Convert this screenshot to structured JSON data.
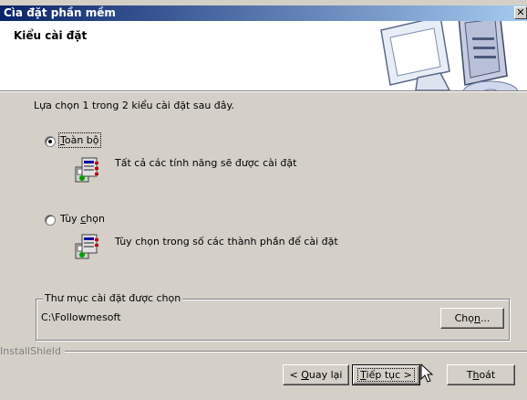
{
  "window": {
    "title": "Cìa đặt phần mềm",
    "close_glyph": "✕"
  },
  "header": {
    "title": "Kiểu cài đặt",
    "art_icon": "computer-cd-icon"
  },
  "instructions": "Lựa chọn 1 trong 2 kiểu cài đặt sau đây.",
  "options": [
    {
      "label_mnemonic": "T",
      "label_rest": "oàn bộ",
      "selected": true,
      "description": "Tất cả các tính năng sẽ được cài đặt",
      "icon": "setup-full-icon"
    },
    {
      "label_pre": "Tùy ",
      "label_mnemonic": "c",
      "label_rest": "họn",
      "selected": false,
      "description": "Tùy chọn trong số các thành phần để cài đặt",
      "icon": "setup-custom-icon"
    }
  ],
  "destination": {
    "legend": "Thư mục cài đặt được chọn",
    "path": "C:\\Followmesoft",
    "browse_pre": "Chọ",
    "browse_mnemonic": "n",
    "browse_rest": "..."
  },
  "brand": "InstallShield",
  "buttons": {
    "back_pre": "< ",
    "back_mnemonic": "Q",
    "back_rest": "uay lại",
    "next_mnemonic": "T",
    "next_rest": "iếp tục >",
    "cancel_pre": "T",
    "cancel_mnemonic": "h",
    "cancel_rest": "oát"
  },
  "colors": {
    "titlebar_start": "#0a246a",
    "titlebar_end": "#a6caf0",
    "face": "#d4d0c8"
  }
}
